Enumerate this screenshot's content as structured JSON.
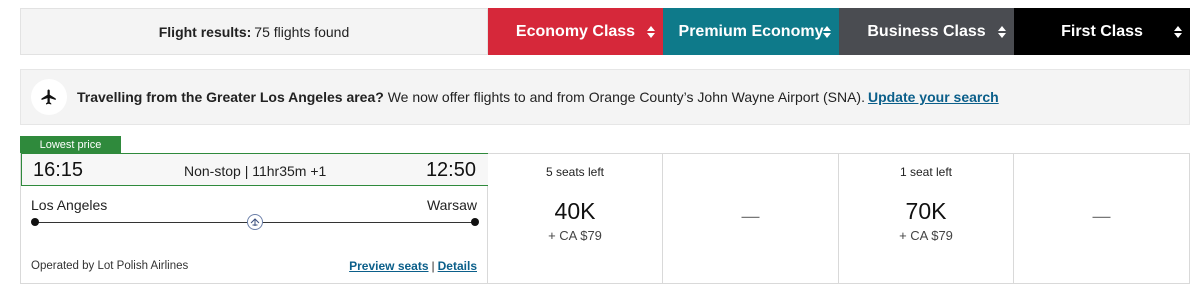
{
  "results": {
    "label": "Flight results:",
    "count_text": "75 flights found"
  },
  "cabins": [
    {
      "label": "Economy Class",
      "color": "#d6283a"
    },
    {
      "label": "Premium Economy",
      "color": "#0e7a8a"
    },
    {
      "label": "Business Class",
      "color": "#4a4c51"
    },
    {
      "label": "First Class",
      "color": "#000000"
    }
  ],
  "notice": {
    "icon": "plane-icon",
    "bold_text": "Travelling from the Greater Los Angeles area?",
    "text": "We now offer flights to and from Orange County’s John Wayne Airport (SNA).",
    "link": "Update your search"
  },
  "flight": {
    "badge": "Lowest price",
    "departure_time": "16:15",
    "arrival_time": "12:50",
    "duration": "Non-stop | 11hr35m +1",
    "origin": "Los Angeles",
    "destination": "Warsaw",
    "airline_logo": "lot-airline-logo",
    "operated_by": "Operated by Lot Polish Airlines",
    "preview_link": "Preview seats",
    "separator": "|",
    "details_link": "Details"
  },
  "fares": [
    {
      "cabin": "Economy Class",
      "seats": "5 seats left",
      "points": "40K",
      "tax": "+ CA $79"
    },
    {
      "cabin": "Premium Economy",
      "unavailable": "—"
    },
    {
      "cabin": "Business Class",
      "seats": "1 seat left",
      "points": "70K",
      "tax": "+ CA $79"
    },
    {
      "cabin": "First Class",
      "unavailable": "—"
    }
  ]
}
